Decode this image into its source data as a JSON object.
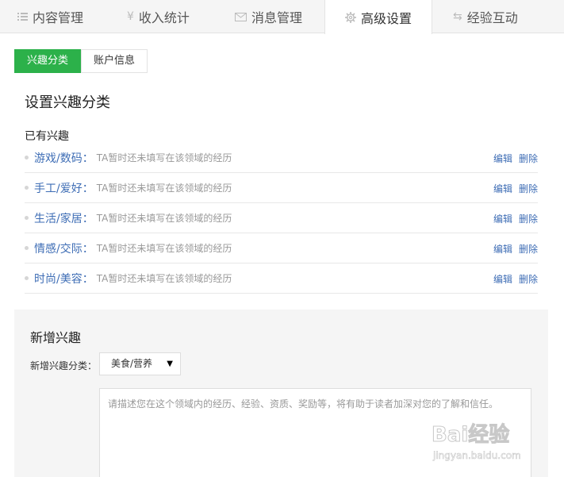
{
  "tabs": [
    {
      "label": "内容管理",
      "icon": "list-icon",
      "active": false
    },
    {
      "label": "收入统计",
      "icon": "yen-icon",
      "active": false
    },
    {
      "label": "消息管理",
      "icon": "mail-icon",
      "active": false
    },
    {
      "label": "高级设置",
      "icon": "gear-icon",
      "active": true
    },
    {
      "label": "经验互动",
      "icon": "swap-icon",
      "active": false
    }
  ],
  "subtabs": [
    {
      "label": "兴趣分类",
      "active": true
    },
    {
      "label": "账户信息",
      "active": false
    }
  ],
  "section_title": "设置兴趣分类",
  "existing_label": "已有兴趣",
  "interests": [
    {
      "category": "游戏/数码：",
      "desc": "TA暂时还未填写在该领域的经历",
      "edit": "编辑",
      "delete": "删除"
    },
    {
      "category": "手工/爱好：",
      "desc": "TA暂时还未填写在该领域的经历",
      "edit": "编辑",
      "delete": "删除"
    },
    {
      "category": "生活/家居：",
      "desc": "TA暂时还未填写在该领域的经历",
      "edit": "编辑",
      "delete": "删除"
    },
    {
      "category": "情感/交际：",
      "desc": "TA暂时还未填写在该领域的经历",
      "edit": "编辑",
      "delete": "删除"
    },
    {
      "category": "时尚/美容：",
      "desc": "TA暂时还未填写在该领域的经历",
      "edit": "编辑",
      "delete": "删除"
    }
  ],
  "add": {
    "title": "新增兴趣",
    "category_label": "新增兴趣分类：",
    "selected": "美食/营养",
    "placeholder": "请描述您在这个领域内的经历、经验、资质、奖励等，将有助于读者加深对您的了解和信任。"
  },
  "watermark": {
    "text": "Bai经验",
    "url": "jingyan.baidu.com"
  },
  "colors": {
    "accent": "#2cb14a",
    "link": "#3e6db5",
    "muted": "#999999"
  }
}
